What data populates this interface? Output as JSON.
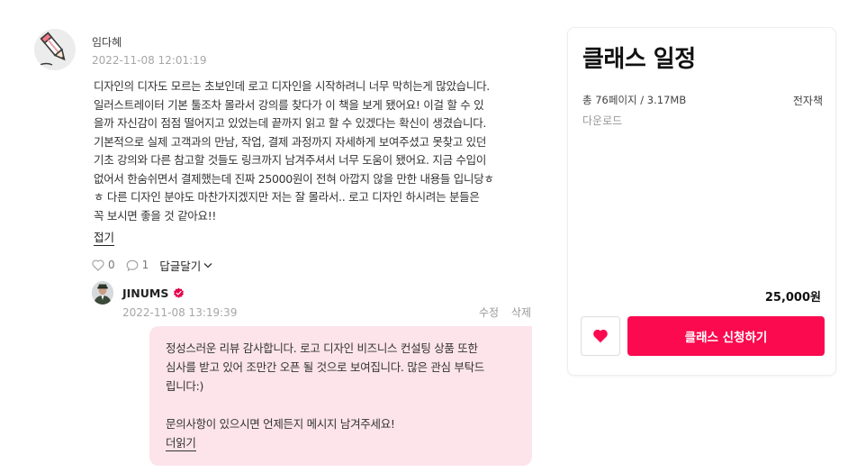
{
  "review": {
    "user_name": "임다혜",
    "date": "2022-11-08 12:01:19",
    "body_lines": [
      "디자인의 디자도 모르는 초보인데 로고 디자인을 시작하려니 너무 막히는게 많았습니다.",
      "일러스트레이터 기본 툴조차 몰라서 강의를 찾다가 이 책을 보게 됐어요! 이걸 할 수 있",
      "을까 자신감이 점점 떨어지고 있었는데 끝까지 읽고 할 수 있겠다는 확신이 생겼습니다.",
      "기본적으로 실제 고객과의 만남, 작업, 결제 과정까지 자세하게 보여주셨고 못찾고 있던",
      "기초 강의와 다른 참고할 것들도 링크까지 남겨주셔서 너무 도움이 됐어요. 지금 수입이",
      "없어서 한숨쉬면서 결제했는데 진짜 25000원이 전혀 아깝지 않을 만한 내용들 입니당ㅎ",
      "ㅎ 다른 디자인 분야도 마찬가지겠지만 저는 잘 몰라서.. 로고 디자인 하시려는 분들은",
      "꼭 보시면 좋을 것 같아요!!"
    ],
    "fold_label": "접기",
    "like_count": "0",
    "comment_count": "1",
    "reply_toggle_label": "답글달기"
  },
  "reply": {
    "seller_name": "JINUMS",
    "date": "2022-11-08 13:19:39",
    "edit_label": "수정",
    "delete_label": "삭제",
    "paragraph1_lines": [
      "정성스러운 리뷰 감사합니다. 로고 디자인 비즈니스 컨설팅 상품 또한",
      "심사를 받고 있어 조만간 오픈 될 것으로 보여집니다. 많은 관심 부탁드",
      "립니다:)"
    ],
    "paragraph2": "문의사항이 있으시면 언제든지 메시지 남겨주세요!",
    "more_label": "더읽기"
  },
  "sidebar": {
    "title": "클래스 일정",
    "meta": "총 76페이지 / 3.17MB",
    "type": "전자책",
    "download": "다운로드",
    "price": "25,000원",
    "apply_label": "클래스 신청하기"
  },
  "colors": {
    "accent": "#fb0a4f",
    "bubble_bg": "#fde4ea",
    "verified_badge": "#e8004c"
  },
  "icons": {
    "user_avatar": "pencil-icon",
    "like": "heart-outline-icon",
    "comment": "speech-bubble-icon",
    "toggle": "chevron-down-icon",
    "verified": "verified-badge-icon",
    "wish": "heart-filled-icon"
  }
}
